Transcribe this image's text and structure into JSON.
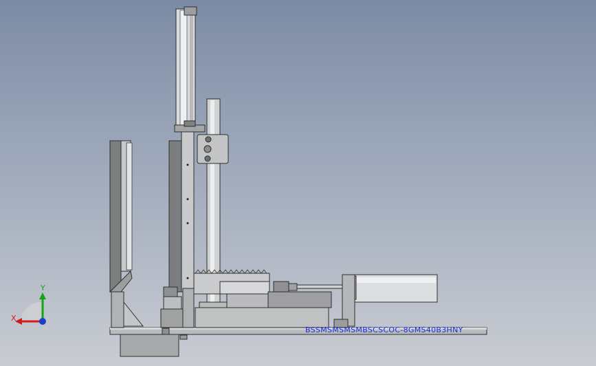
{
  "viewport": {
    "annotation_text": "BSSMSMSMSMBSCSCOC-8GMS40B3HNY",
    "colors": {
      "annotation": "#1c2bd6",
      "axis_x": "#d21a1a",
      "axis_y": "#16a316",
      "axis_z": "#1a3ed2",
      "background_top": "#7c8ba5",
      "background_bottom": "#c9ccd2"
    }
  },
  "triad": {
    "x_label": "X",
    "y_label": "Y"
  }
}
